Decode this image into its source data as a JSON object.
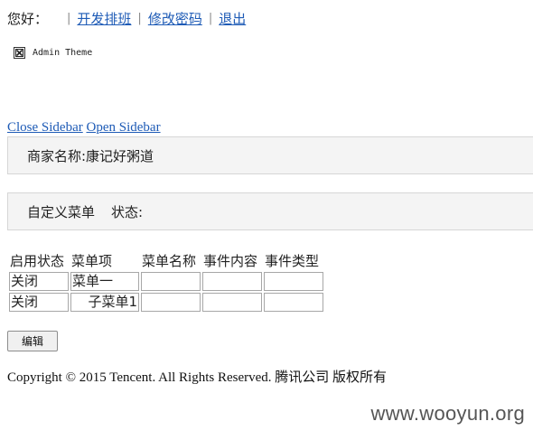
{
  "topbar": {
    "greeting": "您好：",
    "separator": "|",
    "links": [
      {
        "label": "开发排班"
      },
      {
        "label": "修改密码"
      },
      {
        "label": "退出"
      }
    ]
  },
  "theme_image": {
    "icon": "broken-image-icon",
    "alt_text": "Admin Theme"
  },
  "sidebar": {
    "close_label": "Close Sidebar",
    "open_label": "Open Sidebar"
  },
  "merchant": {
    "label": "商家名称:康记好粥道"
  },
  "menu_panel": {
    "title": "自定义菜单",
    "status_label": "状态:"
  },
  "menu_table": {
    "headers": [
      "启用状态",
      "菜单项",
      "菜单名称",
      "事件内容",
      "事件类型"
    ],
    "rows": [
      {
        "status": "关闭",
        "item": "菜单一",
        "name": "",
        "event": "",
        "type": ""
      },
      {
        "status": "关闭",
        "item": "子菜单1",
        "name": "",
        "event": "",
        "type": ""
      }
    ]
  },
  "actions": {
    "edit_label": "编辑"
  },
  "footer": {
    "copyright": "Copyright © 2015 Tencent. All Rights Reserved. 腾讯公司 版权所有"
  },
  "watermark": {
    "text": "www.wooyun.org"
  },
  "colors": {
    "link": "#1e5bb6",
    "panel_bg": "#f4f4f4",
    "panel_border": "#d6d6d6"
  }
}
